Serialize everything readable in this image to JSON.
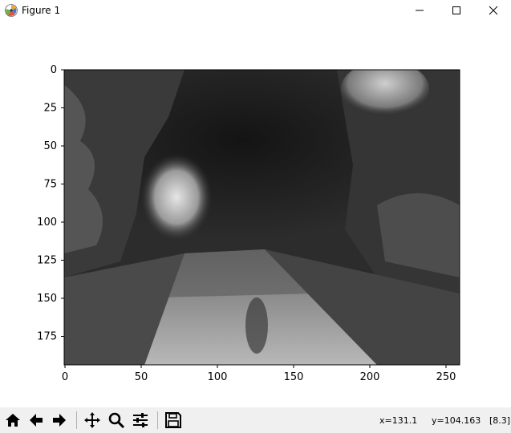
{
  "window": {
    "title": "Figure 1",
    "icons": {
      "app": "matplotlib-icon",
      "minimize": "minimize-icon",
      "maximize": "maximize-icon",
      "close": "close-icon"
    }
  },
  "plot": {
    "image_description_role": "grayscale forest road photograph",
    "x_ticks": [
      "0",
      "50",
      "100",
      "150",
      "200",
      "250"
    ],
    "y_ticks": [
      "0",
      "25",
      "50",
      "75",
      "100",
      "125",
      "150",
      "175"
    ]
  },
  "toolbar": {
    "icons": [
      "home-icon",
      "back-icon",
      "forward-icon",
      "pan-icon",
      "zoom-icon",
      "configure-subplots-icon",
      "save-icon"
    ],
    "status": {
      "x": "x=131.1",
      "y": "y=104.163",
      "value": "[8.3]"
    }
  }
}
